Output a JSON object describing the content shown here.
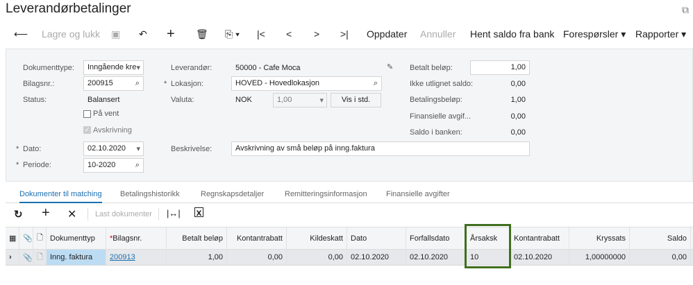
{
  "title": "Leverandørbetalinger",
  "toolbar": {
    "save_close": "Lagre og lukk",
    "update": "Oppdater",
    "cancel": "Annuller",
    "fetch_balance": "Hent saldo fra bank",
    "inquiries": "Forespørsler",
    "reports": "Rapporter"
  },
  "form": {
    "doc_type_label": "Dokumenttype:",
    "doc_type": "Inngående kre",
    "voucher_label": "Bilagsnr.:",
    "voucher": "200915",
    "status_label": "Status:",
    "status": "Balansert",
    "on_hold": "På vent",
    "writeoff": "Avskrivning",
    "date_label": "Dato:",
    "date": "02.10.2020",
    "period_label": "Periode:",
    "period": "10-2020",
    "vendor_label": "Leverandør:",
    "vendor": "50000 - Cafe Moca",
    "location_label": "Lokasjon:",
    "location": "HOVED - Hovedlokasjon",
    "currency_label": "Valuta:",
    "currency": "NOK",
    "rate": "1,00",
    "show_std": "Vis i std.",
    "desc_label": "Beskrivelse:",
    "desc": "Avskrivning av små beløp på inng.faktura",
    "paid_label": "Betalt beløp:",
    "paid": "1,00",
    "unapplied_label": "Ikke utlignet saldo:",
    "unapplied": "0,00",
    "payment_label": "Betalingsbeløp:",
    "payment": "1,00",
    "fin_fees_label": "Finansielle avgif...",
    "fin_fees": "0,00",
    "bank_balance_label": "Saldo i banken:",
    "bank_balance": "0,00"
  },
  "tabs": [
    "Dokumenter til matching",
    "Betalingshistorikk",
    "Regnskapsdetaljer",
    "Remitteringsinformasjon",
    "Finansielle avgifter"
  ],
  "grid": {
    "load_docs": "Last dokumenter",
    "columns": [
      "Dokumenttyp",
      "Bilagsnr.",
      "Betalt beløp",
      "Kontantrabatt",
      "Kildeskatt",
      "Dato",
      "Forfallsdato",
      "Årsaksk",
      "Kontantrabatt",
      "Kryssats",
      "Saldo"
    ],
    "rows": [
      [
        "Inng. faktura",
        "200913",
        "1,00",
        "0,00",
        "0,00",
        "02.10.2020",
        "02.10.2020",
        "10",
        "02.10.2020",
        "1,00000000",
        "0,00"
      ]
    ],
    "highlight_color": "#3f6e1e"
  }
}
